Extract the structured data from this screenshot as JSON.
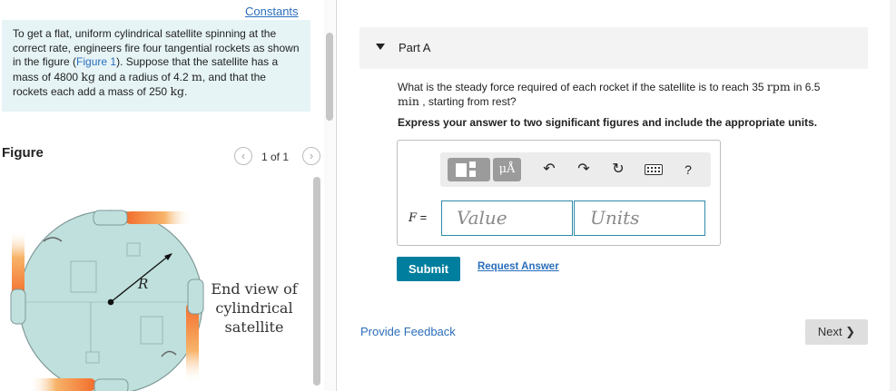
{
  "left_panel": {
    "constants_label": "Constants",
    "problem": {
      "t1": "To get a flat, uniform cylindrical satellite spinning at the correct rate, engineers fire four tangential rockets as shown in the figure (",
      "figure_link": "Figure 1",
      "t2": "). Suppose that the satellite has a mass of 4800 ",
      "mass_unit": "kg",
      "t3": " and a radius of 4.2 ",
      "radius_unit": "m",
      "t4": ", and that the rockets each add a mass of 250 ",
      "rocket_unit": "kg",
      "t5": "."
    },
    "figure": {
      "title": "Figure",
      "prev_icon": "‹",
      "next_icon": "›",
      "counter": "1 of 1",
      "radius_label": "R",
      "caption_line1": "End view of",
      "caption_line2": "cylindrical",
      "caption_line3": "satellite"
    }
  },
  "part": {
    "arrow_icon": "caret-down-icon",
    "title": "Part A",
    "question_pre": "What is the steady force required of each rocket if the satellite is to reach 35 ",
    "question_rpm": "rpm",
    "question_mid": " in 6.5 ",
    "question_min": "min",
    "question_post": " , starting from rest?",
    "instruction": "Express your answer to two significant figures and include the appropriate units."
  },
  "answer": {
    "toolbar": {
      "mu_label": "μÅ",
      "undo_icon": "↶",
      "redo_icon": "↷",
      "reset_icon": "↻",
      "help_label": "?"
    },
    "variable": "F",
    "equals": " =",
    "value_placeholder": "Value",
    "units_placeholder": "Units"
  },
  "actions": {
    "submit_label": "Submit",
    "request_label": "Request Answer",
    "feedback_label": "Provide Feedback",
    "next_label": "Next",
    "next_chevron": "❯"
  },
  "colors": {
    "link": "#2a6ebb",
    "submit": "#007e9e",
    "problem_bg": "#e6f4f6",
    "satellite": "#bfe0dc",
    "flame": "#f08a3a"
  }
}
